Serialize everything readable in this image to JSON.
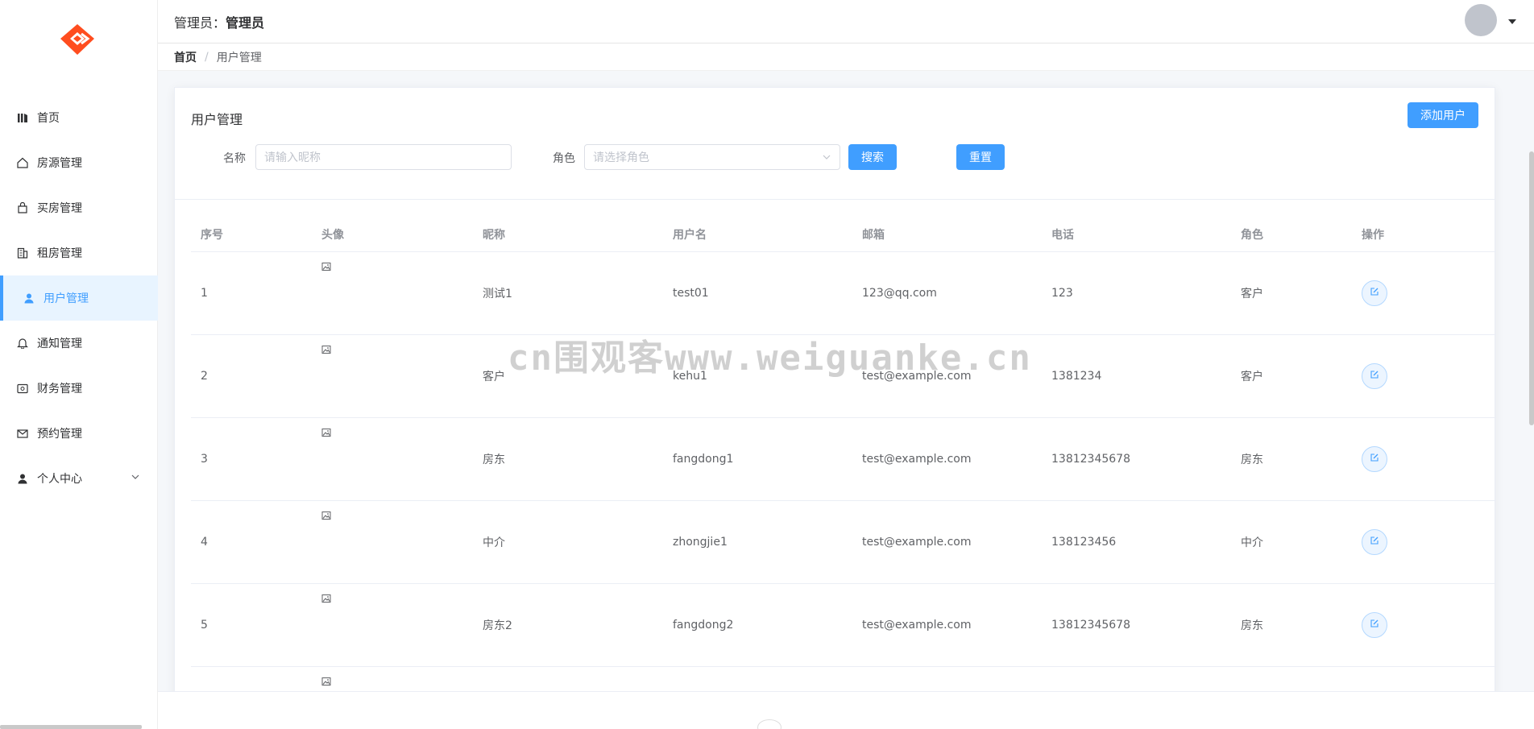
{
  "header": {
    "admin_prefix": "管理员：",
    "admin_name": "管理员"
  },
  "breadcrumb": {
    "home": "首页",
    "separator": "/",
    "current": "用户管理"
  },
  "sidebar": {
    "items": [
      {
        "label": "首页",
        "icon": "chart-icon"
      },
      {
        "label": "房源管理",
        "icon": "house-icon"
      },
      {
        "label": "买房管理",
        "icon": "bag-icon"
      },
      {
        "label": "租房管理",
        "icon": "building-icon"
      },
      {
        "label": "用户管理",
        "icon": "user-icon",
        "active": true
      },
      {
        "label": "通知管理",
        "icon": "bell-icon"
      },
      {
        "label": "财务管理",
        "icon": "wallet-icon"
      },
      {
        "label": "预约管理",
        "icon": "mail-icon"
      },
      {
        "label": "个人中心",
        "icon": "user-icon",
        "expandable": true
      }
    ]
  },
  "card": {
    "title": "用户管理",
    "add_button": "添加用户",
    "filters": {
      "name_label": "名称",
      "name_placeholder": "请输入昵称",
      "role_label": "角色",
      "role_placeholder": "请选择角色",
      "search_button": "搜索",
      "reset_button": "重置"
    }
  },
  "table": {
    "columns": [
      "序号",
      "头像",
      "昵称",
      "用户名",
      "邮箱",
      "电话",
      "角色",
      "操作"
    ],
    "rows": [
      {
        "idx": "1",
        "nickname": "测试1",
        "username": "test01",
        "email": "123@qq.com",
        "phone": "123",
        "role": "客户"
      },
      {
        "idx": "2",
        "nickname": "客户",
        "username": "kehu1",
        "email": "test@example.com",
        "phone": "1381234",
        "role": "客户"
      },
      {
        "idx": "3",
        "nickname": "房东",
        "username": "fangdong1",
        "email": "test@example.com",
        "phone": "13812345678",
        "role": "房东"
      },
      {
        "idx": "4",
        "nickname": "中介",
        "username": "zhongjie1",
        "email": "test@example.com",
        "phone": "138123456",
        "role": "中介"
      },
      {
        "idx": "5",
        "nickname": "房东2",
        "username": "fangdong2",
        "email": "test@example.com",
        "phone": "13812345678",
        "role": "房东"
      },
      {
        "idx": "",
        "nickname": "",
        "username": "",
        "email": "",
        "phone": "",
        "role": ""
      }
    ]
  },
  "watermark": "cn围观客www.weiguanke.cn",
  "colors": {
    "primary": "#409eff",
    "logo": "#ff4d1f",
    "active_bg": "#e8f4ff"
  }
}
